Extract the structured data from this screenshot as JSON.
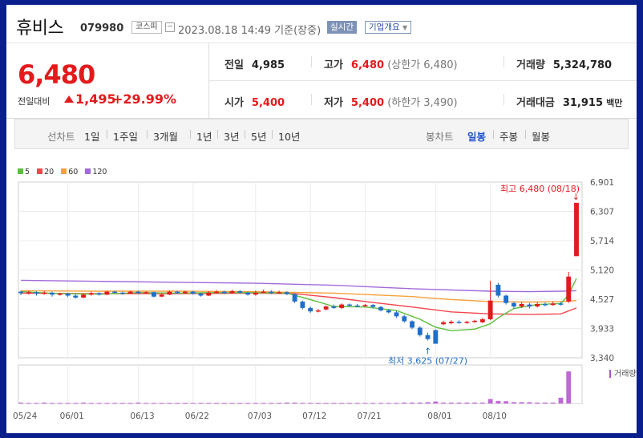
{
  "stock": {
    "name": "휴비스",
    "code": "079980",
    "market": "코스피",
    "datetime": "2023.08.18 14:49",
    "basis": "기준(장중)",
    "live_label": "실시간",
    "company_info_label": "기업개요",
    "price": "6,480",
    "change_label": "전일대비",
    "change": "1,495",
    "change_pct": "+29.99%"
  },
  "quote": {
    "prev_close": {
      "label": "전일",
      "value": "4,985"
    },
    "high": {
      "label": "고가",
      "value": "6,480",
      "note": "(상한가 6,480)"
    },
    "volume": {
      "label": "거래량",
      "value": "5,324,780"
    },
    "open": {
      "label": "시가",
      "value": "5,400"
    },
    "low": {
      "label": "저가",
      "value": "5,400",
      "note": "(하한가 3,490)"
    },
    "amount": {
      "label": "거래대금",
      "value": "31,915",
      "unit": "백만"
    }
  },
  "tabs": {
    "line_label": "선차트",
    "line_periods": [
      "1일",
      "1주일",
      "3개월",
      "1년",
      "3년",
      "5년",
      "10년"
    ],
    "candle_label": "봉차트",
    "candle_periods": [
      "일봉",
      "주봉",
      "월봉"
    ],
    "active_candle": "일봉"
  },
  "colors": {
    "up": "#e31a1c",
    "down": "#1f6fc8",
    "ma5": "#5cbf3a",
    "ma20": "#f2464c",
    "ma60": "#f7a13b",
    "ma120": "#a26ad9"
  },
  "chart_data": {
    "type": "candlestick",
    "legend": [
      {
        "name": "5",
        "color": "#5cbf3a"
      },
      {
        "name": "20",
        "color": "#f2464c"
      },
      {
        "name": "60",
        "color": "#f7a13b"
      },
      {
        "name": "120",
        "color": "#a26ad9"
      }
    ],
    "y_ticks": [
      "6,901",
      "6,307",
      "5,714",
      "5,120",
      "4,527",
      "3,933",
      "3,340"
    ],
    "ylim": [
      3340,
      6901
    ],
    "x_ticks": [
      "05/24",
      "06/01",
      "06/13",
      "06/22",
      "07/03",
      "07/12",
      "07/21",
      "08/01",
      "08/10"
    ],
    "high_annotation": "최고 6,480 (08/18)",
    "low_annotation": "최저 3,625 (07/27)",
    "volume_label": "거래량",
    "candles": [
      {
        "o": 4680,
        "c": 4650,
        "h": 4700,
        "l": 4610
      },
      {
        "o": 4650,
        "c": 4670,
        "h": 4700,
        "l": 4620
      },
      {
        "o": 4670,
        "c": 4640,
        "h": 4690,
        "l": 4600
      },
      {
        "o": 4640,
        "c": 4660,
        "h": 4690,
        "l": 4620
      },
      {
        "o": 4660,
        "c": 4620,
        "h": 4680,
        "l": 4580
      },
      {
        "o": 4620,
        "c": 4640,
        "h": 4660,
        "l": 4600
      },
      {
        "o": 4640,
        "c": 4600,
        "h": 4660,
        "l": 4570
      },
      {
        "o": 4600,
        "c": 4560,
        "h": 4630,
        "l": 4540
      },
      {
        "o": 4560,
        "c": 4620,
        "h": 4640,
        "l": 4550
      },
      {
        "o": 4620,
        "c": 4650,
        "h": 4680,
        "l": 4600
      },
      {
        "o": 4650,
        "c": 4620,
        "h": 4670,
        "l": 4600
      },
      {
        "o": 4620,
        "c": 4680,
        "h": 4700,
        "l": 4610
      },
      {
        "o": 4680,
        "c": 4660,
        "h": 4700,
        "l": 4640
      },
      {
        "o": 4660,
        "c": 4640,
        "h": 4680,
        "l": 4620
      },
      {
        "o": 4640,
        "c": 4680,
        "h": 4700,
        "l": 4630
      },
      {
        "o": 4680,
        "c": 4650,
        "h": 4700,
        "l": 4630
      },
      {
        "o": 4650,
        "c": 4670,
        "h": 4690,
        "l": 4640
      },
      {
        "o": 4670,
        "c": 4580,
        "h": 4680,
        "l": 4560
      },
      {
        "o": 4580,
        "c": 4620,
        "h": 4640,
        "l": 4570
      },
      {
        "o": 4620,
        "c": 4680,
        "h": 4700,
        "l": 4610
      },
      {
        "o": 4680,
        "c": 4650,
        "h": 4700,
        "l": 4630
      },
      {
        "o": 4650,
        "c": 4680,
        "h": 4700,
        "l": 4630
      },
      {
        "o": 4680,
        "c": 4640,
        "h": 4700,
        "l": 4620
      },
      {
        "o": 4640,
        "c": 4600,
        "h": 4660,
        "l": 4580
      },
      {
        "o": 4600,
        "c": 4660,
        "h": 4690,
        "l": 4590
      },
      {
        "o": 4660,
        "c": 4680,
        "h": 4710,
        "l": 4640
      },
      {
        "o": 4680,
        "c": 4650,
        "h": 4700,
        "l": 4630
      },
      {
        "o": 4650,
        "c": 4690,
        "h": 4720,
        "l": 4640
      },
      {
        "o": 4690,
        "c": 4660,
        "h": 4710,
        "l": 4640
      },
      {
        "o": 4660,
        "c": 4620,
        "h": 4680,
        "l": 4600
      },
      {
        "o": 4620,
        "c": 4660,
        "h": 4700,
        "l": 4600
      },
      {
        "o": 4660,
        "c": 4680,
        "h": 4720,
        "l": 4650
      },
      {
        "o": 4680,
        "c": 4650,
        "h": 4710,
        "l": 4630
      },
      {
        "o": 4650,
        "c": 4670,
        "h": 4700,
        "l": 4640
      },
      {
        "o": 4670,
        "c": 4630,
        "h": 4690,
        "l": 4610
      },
      {
        "o": 4630,
        "c": 4480,
        "h": 4650,
        "l": 4450
      },
      {
        "o": 4480,
        "c": 4350,
        "h": 4500,
        "l": 4320
      },
      {
        "o": 4350,
        "c": 4280,
        "h": 4380,
        "l": 4250
      },
      {
        "o": 4280,
        "c": 4300,
        "h": 4330,
        "l": 4260
      },
      {
        "o": 4320,
        "c": 4380,
        "h": 4400,
        "l": 4300
      },
      {
        "o": 4380,
        "c": 4350,
        "h": 4420,
        "l": 4330
      },
      {
        "o": 4350,
        "c": 4420,
        "h": 4440,
        "l": 4330
      },
      {
        "o": 4420,
        "c": 4400,
        "h": 4440,
        "l": 4380
      },
      {
        "o": 4400,
        "c": 4390,
        "h": 4430,
        "l": 4370
      },
      {
        "o": 4390,
        "c": 4410,
        "h": 4430,
        "l": 4370
      },
      {
        "o": 4410,
        "c": 4370,
        "h": 4430,
        "l": 4350
      },
      {
        "o": 4370,
        "c": 4300,
        "h": 4390,
        "l": 4280
      },
      {
        "o": 4300,
        "c": 4260,
        "h": 4330,
        "l": 4240
      },
      {
        "o": 4260,
        "c": 4180,
        "h": 4290,
        "l": 4150
      },
      {
        "o": 4180,
        "c": 4080,
        "h": 4210,
        "l": 4050
      },
      {
        "o": 4080,
        "c": 3950,
        "h": 4100,
        "l": 3920
      },
      {
        "o": 3950,
        "c": 3800,
        "h": 3980,
        "l": 3770
      },
      {
        "o": 3800,
        "c": 3720,
        "h": 3850,
        "l": 3690
      },
      {
        "o": 3900,
        "c": 3625,
        "h": 3920,
        "l": 3625
      },
      {
        "o": 4020,
        "c": 4060,
        "h": 4090,
        "l": 4000
      },
      {
        "o": 4040,
        "c": 4070,
        "h": 4100,
        "l": 4020
      },
      {
        "o": 4070,
        "c": 4050,
        "h": 4100,
        "l": 4030
      },
      {
        "o": 4050,
        "c": 4070,
        "h": 4090,
        "l": 4030
      },
      {
        "o": 4070,
        "c": 4090,
        "h": 4110,
        "l": 4050
      },
      {
        "o": 4060,
        "c": 4120,
        "h": 4150,
        "l": 4040
      },
      {
        "o": 4120,
        "c": 4500,
        "h": 4900,
        "l": 4100
      },
      {
        "o": 4820,
        "c": 4600,
        "h": 4860,
        "l": 4560
      },
      {
        "o": 4600,
        "c": 4450,
        "h": 4620,
        "l": 4420
      },
      {
        "o": 4450,
        "c": 4380,
        "h": 4480,
        "l": 4330
      },
      {
        "o": 4380,
        "c": 4430,
        "h": 4470,
        "l": 4350
      },
      {
        "o": 4420,
        "c": 4380,
        "h": 4450,
        "l": 4340
      },
      {
        "o": 4380,
        "c": 4430,
        "h": 4470,
        "l": 4360
      },
      {
        "o": 4430,
        "c": 4410,
        "h": 4460,
        "l": 4380
      },
      {
        "o": 4410,
        "c": 4440,
        "h": 4480,
        "l": 4390
      },
      {
        "o": 4440,
        "c": 4420,
        "h": 4470,
        "l": 4400
      },
      {
        "o": 4480,
        "c": 4985,
        "h": 5080,
        "l": 4450
      },
      {
        "o": 5400,
        "c": 6480,
        "h": 6480,
        "l": 5400
      }
    ],
    "volume": [
      3,
      2,
      2,
      3,
      2,
      2,
      2,
      2,
      3,
      2,
      2,
      2,
      2,
      2,
      2,
      3,
      2,
      2,
      2,
      2,
      2,
      2,
      2,
      2,
      2,
      2,
      2,
      2,
      2,
      2,
      2,
      2,
      2,
      2,
      3,
      3,
      2,
      2,
      2,
      2,
      2,
      2,
      2,
      2,
      2,
      2,
      2,
      2,
      2,
      3,
      3,
      3,
      4,
      6,
      3,
      3,
      3,
      3,
      3,
      3,
      14,
      8,
      7,
      4,
      4,
      4,
      3,
      3,
      3,
      18,
      100
    ],
    "ma_lines": {
      "ma5": [
        [
          0,
          4680
        ],
        [
          5,
          4640
        ],
        [
          10,
          4630
        ],
        [
          15,
          4660
        ],
        [
          20,
          4650
        ],
        [
          25,
          4660
        ],
        [
          30,
          4660
        ],
        [
          34,
          4650
        ],
        [
          37,
          4520
        ],
        [
          40,
          4380
        ],
        [
          44,
          4370
        ],
        [
          48,
          4300
        ],
        [
          51,
          4120
        ],
        [
          53,
          3960
        ],
        [
          55,
          3890
        ],
        [
          58,
          3920
        ],
        [
          60,
          4030
        ],
        [
          61,
          4150
        ],
        [
          63,
          4340
        ],
        [
          66,
          4420
        ],
        [
          69,
          4440
        ],
        [
          70,
          4620
        ],
        [
          71,
          4950
        ]
      ],
      "ma20": [
        [
          0,
          4650
        ],
        [
          10,
          4640
        ],
        [
          20,
          4640
        ],
        [
          30,
          4650
        ],
        [
          35,
          4640
        ],
        [
          40,
          4560
        ],
        [
          45,
          4460
        ],
        [
          50,
          4370
        ],
        [
          55,
          4270
        ],
        [
          60,
          4230
        ],
        [
          65,
          4220
        ],
        [
          69,
          4230
        ],
        [
          71,
          4350
        ]
      ],
      "ma60": [
        [
          0,
          4700
        ],
        [
          10,
          4690
        ],
        [
          20,
          4690
        ],
        [
          30,
          4680
        ],
        [
          40,
          4650
        ],
        [
          50,
          4580
        ],
        [
          55,
          4520
        ],
        [
          60,
          4480
        ],
        [
          65,
          4470
        ],
        [
          69,
          4480
        ],
        [
          71,
          4500
        ]
      ],
      "ma120": [
        [
          0,
          4910
        ],
        [
          10,
          4890
        ],
        [
          20,
          4870
        ],
        [
          30,
          4850
        ],
        [
          40,
          4810
        ],
        [
          50,
          4740
        ],
        [
          60,
          4690
        ],
        [
          65,
          4680
        ],
        [
          69,
          4690
        ],
        [
          71,
          4700
        ]
      ]
    }
  }
}
